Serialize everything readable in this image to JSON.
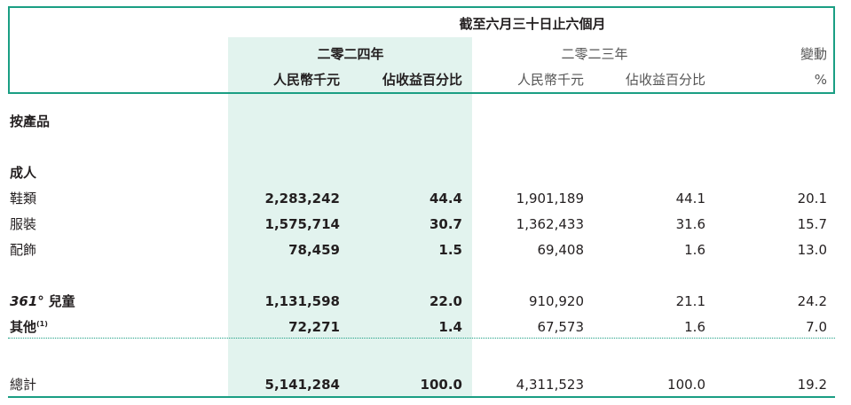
{
  "header": {
    "period": "截至六月三十日止六個月",
    "year_2024": "二零二四年",
    "year_2023": "二零二三年",
    "change": "變動",
    "rmb_2024": "人民幣千元",
    "pct_2024": "佔收益百分比",
    "rmb_2023": "人民幣千元",
    "pct_2023": "佔收益百分比",
    "change_unit": "%"
  },
  "section_title": "按產品",
  "adult_title": "成人",
  "rows": [
    {
      "label": "鞋類",
      "v2024": "2,283,242",
      "p2024": "44.4",
      "v2023": "1,901,189",
      "p2023": "44.1",
      "chg": "20.1"
    },
    {
      "label": "服裝",
      "v2024": "1,575,714",
      "p2024": "30.7",
      "v2023": "1,362,433",
      "p2023": "31.6",
      "chg": "15.7"
    },
    {
      "label": "配飾",
      "v2024": "78,459",
      "p2024": "1.5",
      "v2023": "69,408",
      "p2023": "1.6",
      "chg": "13.0"
    }
  ],
  "kids": {
    "brand": "361°",
    "label": "兒童",
    "v2024": "1,131,598",
    "p2024": "22.0",
    "v2023": "910,920",
    "p2023": "21.1",
    "chg": "24.2"
  },
  "others": {
    "label": "其他",
    "note": "(1)",
    "v2024": "72,271",
    "p2024": "1.4",
    "v2023": "67,573",
    "p2023": "1.6",
    "chg": "7.0"
  },
  "total": {
    "label": "總計",
    "v2024": "5,141,284",
    "p2024": "100.0",
    "v2023": "4,311,523",
    "p2023": "100.0",
    "chg": "19.2"
  },
  "colors": {
    "accent": "#1a9e83",
    "highlight": "#e2f3ee"
  }
}
